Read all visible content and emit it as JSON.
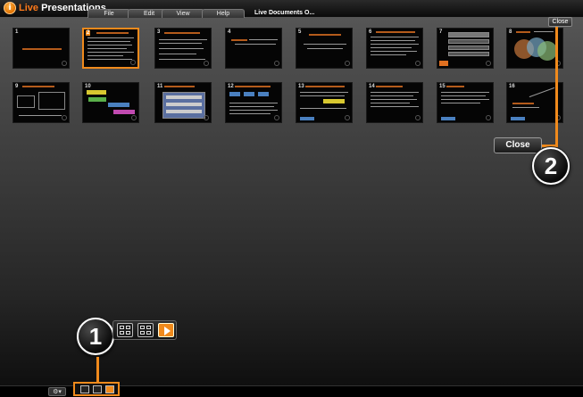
{
  "app": {
    "title_prefix": "Live",
    "title_main": "Presentations",
    "logo_letter": "i"
  },
  "menu": [
    {
      "label": "File"
    },
    {
      "label": "Edit"
    },
    {
      "label": "View"
    },
    {
      "label": "Help"
    }
  ],
  "document_title": "Live Documents  O...",
  "close_small_label": "Close",
  "callouts": {
    "close_label": "Close",
    "badge_1": "1",
    "badge_2": "2"
  },
  "slides": [
    {
      "number": "1",
      "selected": false
    },
    {
      "number": "2",
      "selected": true
    },
    {
      "number": "3",
      "selected": false
    },
    {
      "number": "4",
      "selected": false
    },
    {
      "number": "5",
      "selected": false
    },
    {
      "number": "6",
      "selected": false
    },
    {
      "number": "7",
      "selected": false
    },
    {
      "number": "8",
      "selected": false
    },
    {
      "number": "9",
      "selected": false
    },
    {
      "number": "10",
      "selected": false
    },
    {
      "number": "11",
      "selected": false
    },
    {
      "number": "12",
      "selected": false
    },
    {
      "number": "13",
      "selected": false
    },
    {
      "number": "14",
      "selected": false
    },
    {
      "number": "15",
      "selected": false
    },
    {
      "number": "16",
      "selected": false
    }
  ],
  "colors": {
    "accent": "#f08a1c",
    "background_top": "#5a5a5a",
    "background_bottom": "#0c0c0c"
  }
}
